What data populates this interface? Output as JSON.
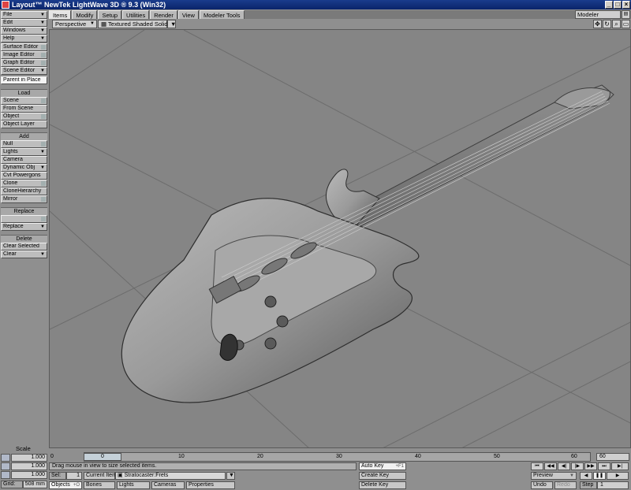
{
  "window": {
    "title": "Layout™ NewTek LightWave 3D ® 9.3 (Win32)"
  },
  "tabs": [
    {
      "label": "Items",
      "active": true
    },
    {
      "label": "Modify"
    },
    {
      "label": "Setup"
    },
    {
      "label": "Utilities"
    },
    {
      "label": "Render"
    },
    {
      "label": "View"
    },
    {
      "label": "Modeler Tools"
    }
  ],
  "modeler_select": "Modeler",
  "sidebar": {
    "menus": [
      "File",
      "Edit",
      "Windows",
      "Help"
    ],
    "editors": [
      "Surface Editor",
      "Image Editor",
      "Graph Editor",
      "Scene Editor"
    ],
    "parent_in_place": "Parent in Place",
    "load_header": "Load",
    "load_items": [
      "Scene",
      "From Scene",
      "Object",
      "Object Layer"
    ],
    "add_header": "Add",
    "add_items": [
      "Null",
      "Lights",
      "Camera",
      "Dynamic Obj",
      "Cvt Powergons",
      "Clone",
      "CloneHierarchy",
      "Mirror"
    ],
    "replace_header": "Replace",
    "replace_items": [
      "Replace"
    ],
    "delete_header": "Delete",
    "delete_items": [
      "Clear Selected",
      "Clear"
    ]
  },
  "viewport": {
    "view_mode": "Perspective",
    "shading_mode": "Textured Shaded Solid"
  },
  "bottom": {
    "scale_label": "Scale",
    "value1": "1.000",
    "value2": "1.000",
    "value3": "1.000",
    "grid_label": "Grid:",
    "grid_value": "508 mm",
    "status_text": "Drag mouse in view to size selected items.",
    "sel_label": "Sel:",
    "sel_value": "1",
    "current_item_label": "Current Item",
    "current_item_value": "Stratocaster:Frets",
    "objects_label": "Objects",
    "objects_hotkey": "+O",
    "bones_label": "Bones",
    "lights_label": "Lights",
    "cameras_label": "Cameras",
    "properties_label": "Properties",
    "auto_key_label": "Auto Key",
    "auto_key_hotkey": "+F1",
    "create_key_label": "Create Key",
    "delete_key_label": "Delete Key",
    "preview_label": "Preview",
    "undo_label": "Undo",
    "redo_label": "Redo",
    "step_label": "Step",
    "step_value": "1",
    "frame_start": "0",
    "frame_current": "0",
    "frame_end": "60",
    "ticks": [
      "10",
      "20",
      "30",
      "40",
      "50",
      "60"
    ]
  }
}
